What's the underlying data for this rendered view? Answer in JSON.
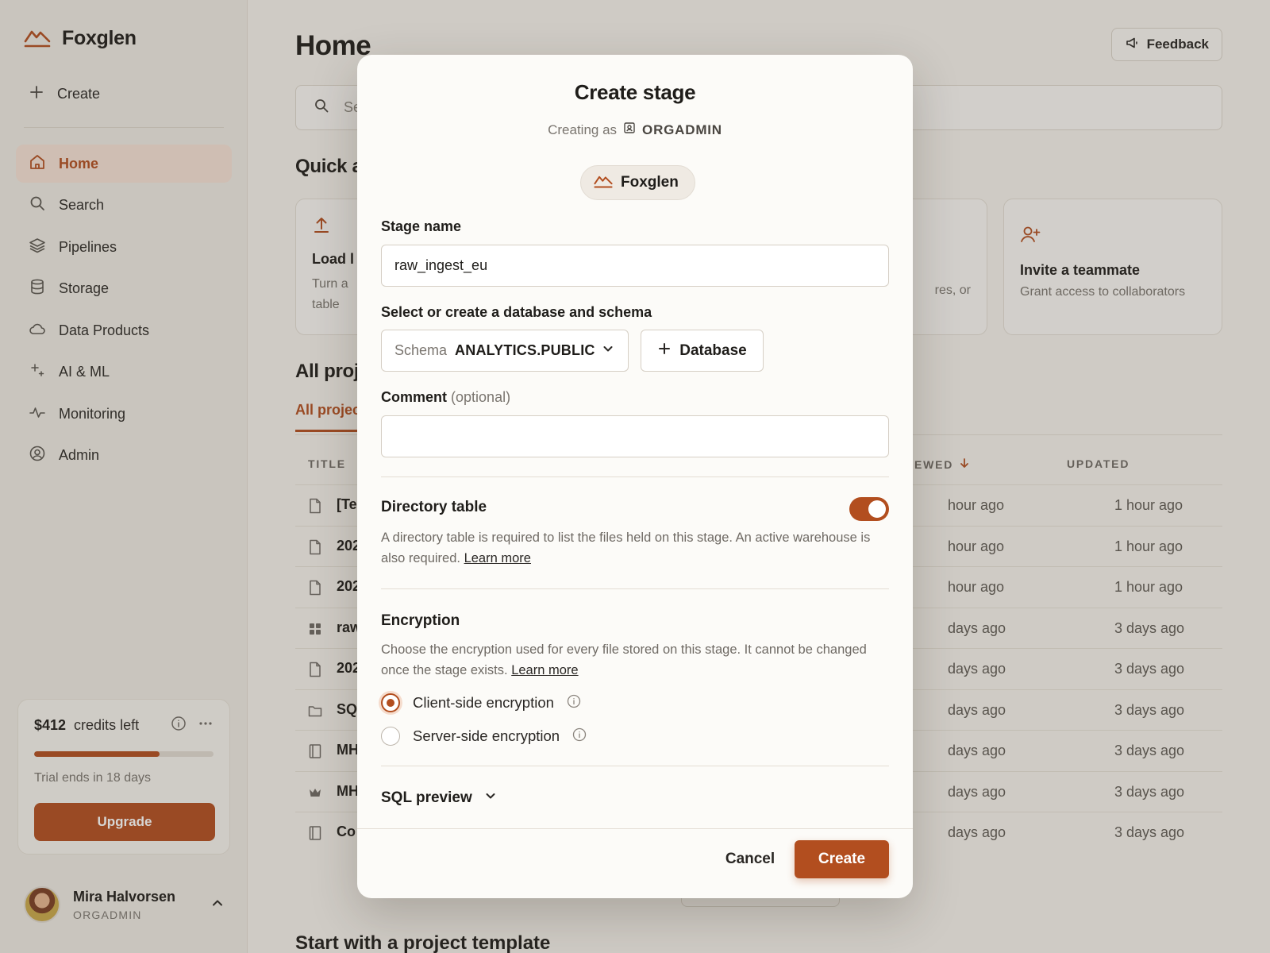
{
  "sidebar": {
    "brand": "Foxglen",
    "create_label": "Create",
    "nav": [
      {
        "label": "Home",
        "icon": "home-icon",
        "active": true
      },
      {
        "label": "Search",
        "icon": "search-icon"
      },
      {
        "label": "Pipelines",
        "icon": "layers-icon"
      },
      {
        "label": "Storage",
        "icon": "database-icon"
      },
      {
        "label": "Data Products",
        "icon": "cloud-icon"
      },
      {
        "label": "AI & ML",
        "icon": "sparkle-icon"
      },
      {
        "label": "Monitoring",
        "icon": "activity-icon"
      },
      {
        "label": "Admin",
        "icon": "user-circle-icon"
      }
    ],
    "credits": {
      "amount": "$412",
      "label": "credits left",
      "progress_fraction": 0.7,
      "trial_text": "Trial ends in 18 days",
      "upgrade_label": "Upgrade"
    },
    "user": {
      "name": "Mira Halvorsen",
      "role": "ORGADMIN"
    }
  },
  "main": {
    "title": "Home",
    "feedback_label": "Feedback",
    "search_placeholder": "Se",
    "quick_actions_heading": "Quick a",
    "quick_actions": [
      {
        "title": "Load l",
        "desc_line1": "Turn a",
        "desc_line2": "table"
      },
      {
        "title": "",
        "desc_line1": "res, or",
        "desc_line2": ""
      },
      {
        "title": "Invite a teammate",
        "desc_line1": "Grant access to collaborators",
        "desc_line2": ""
      }
    ],
    "projects_heading": "All proj",
    "tab_active": "All projec",
    "columns": {
      "title": "TITLE",
      "viewed": "EWED",
      "updated": "UPDATED"
    },
    "rows": [
      {
        "title": "[Te",
        "icon": "file-icon",
        "viewed": "hour ago",
        "updated": "1 hour ago"
      },
      {
        "title": "202",
        "icon": "file-icon",
        "viewed": "hour ago",
        "updated": "1 hour ago"
      },
      {
        "title": "202",
        "icon": "file-icon",
        "viewed": "hour ago",
        "updated": "1 hour ago"
      },
      {
        "title": "raw",
        "icon": "grid-icon",
        "viewed": "days ago",
        "updated": "3 days ago"
      },
      {
        "title": "202",
        "icon": "file-icon",
        "viewed": "days ago",
        "updated": "3 days ago"
      },
      {
        "title": "SQ",
        "icon": "folder-icon",
        "viewed": "days ago",
        "updated": "3 days ago"
      },
      {
        "title": "MH",
        "icon": "notebook-icon",
        "viewed": "days ago",
        "updated": "3 days ago"
      },
      {
        "title": "MH",
        "icon": "crown-icon",
        "viewed": "days ago",
        "updated": "3 days ago"
      },
      {
        "title": "Co",
        "icon": "notebook-icon",
        "viewed": "days ago",
        "updated": "3 days ago"
      }
    ],
    "templates_heading": "Start with a project template"
  },
  "modal": {
    "title": "Create stage",
    "creating_as_label": "Creating as",
    "creating_as_role": "ORGADMIN",
    "org_chip": "Foxglen",
    "stage_name_label": "Stage name",
    "stage_name_value": "raw_ingest_eu",
    "db_schema_label": "Select or create a database and schema",
    "schema_key": "Schema",
    "schema_value": "ANALYTICS.PUBLIC",
    "database_button": "Database",
    "comment_label": "Comment",
    "comment_optional": "(optional)",
    "comment_value": "",
    "directory_heading": "Directory table",
    "directory_enabled": true,
    "directory_desc": "A directory table is required to list the files held on this stage. An active warehouse is also required.",
    "learn_more": "Learn more",
    "encryption_heading": "Encryption",
    "encryption_desc": "Choose the encryption used for every file stored on this stage. It cannot be changed once the stage exists.",
    "options": [
      {
        "label": "Client-side encryption",
        "selected": true
      },
      {
        "label": "Server-side encryption",
        "selected": false
      }
    ],
    "sql_preview": "SQL preview",
    "cancel_label": "Cancel",
    "create_label": "Create"
  },
  "colors": {
    "accent": "#b24e1f",
    "accent_soft": "#f6e2d6",
    "background": "#f6f3ee"
  }
}
